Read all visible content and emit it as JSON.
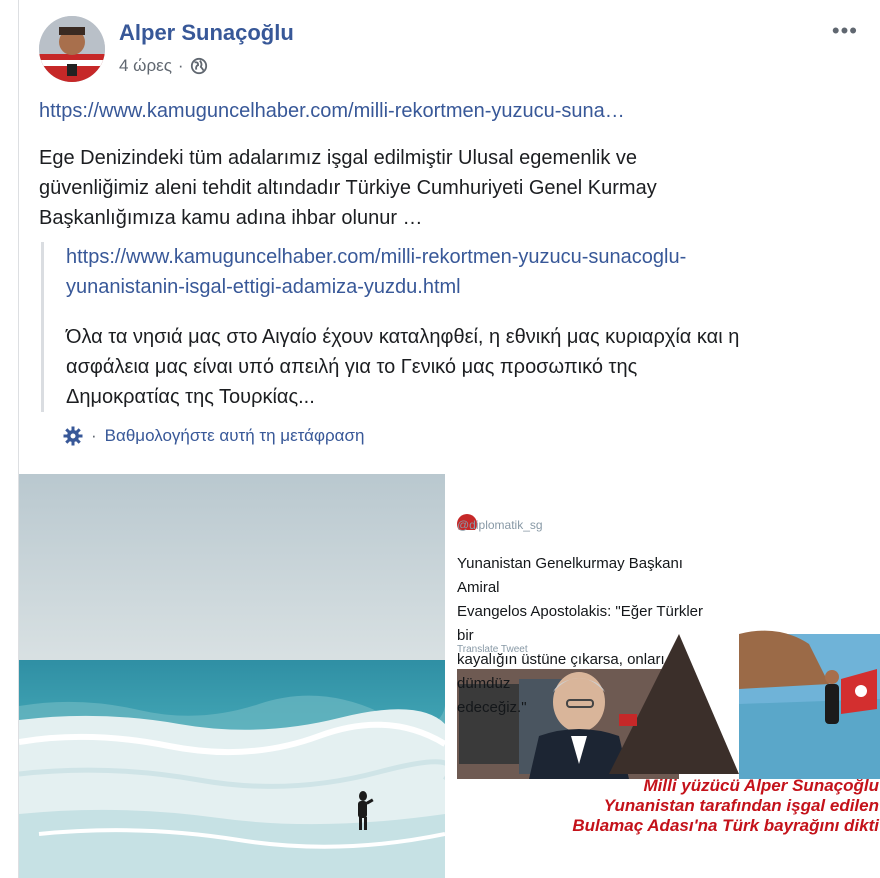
{
  "post": {
    "author": "Alper Sunaçoğlu",
    "time": "4 ώρες",
    "time_separator": "·",
    "more_label": "•••",
    "link": "https://www.kamuguncelhaber.com/milli-rekortmen-yuzucu-suna…",
    "text_lines": [
      "Ege Denizindeki tüm adalarımız işgal edilmiştir Ulusal egemenlik ve",
      "güvenliğimiz aleni tehdit altındadır Türkiye Cumhuriyeti Genel Kurmay",
      "Başkanlığımıza kamu adına ihbar olunur …"
    ],
    "quote_link_lines": [
      "https://www.kamuguncelhaber.com/milli-rekortmen-yuzucu-sunacoglu-",
      "yunanistanin-isgal-ettigi-adamiza-yuzdu.html"
    ],
    "translation_lines": [
      "Όλα τα νησιά μας στο Αιγαίο έχουν καταληφθεί, η εθνική μας κυριαρχία και η",
      "ασφάλεια μας είναι υπό απειλή για το Γενικό μας προσωπικό της",
      "Δημοκρατίας της Τουρκίας..."
    ],
    "rate_separator": "·",
    "rate_translation": "Βαθμολογήστε αυτή τη μετάφραση"
  },
  "image_right": {
    "handle": "@diplomatik_sg",
    "tweet_lines": [
      "Yunanistan Genelkurmay Başkanı Amiral",
      "Evangelos Apostolakis: \"Eğer Türkler bir",
      "kayalığın üstüne çıkarsa, onları dümdüz",
      "edeceğiz.\""
    ],
    "translate_tweet": "Translate Tweet",
    "caption_lines": [
      "Milli yüzücü Alper Sunaçoğlu",
      "Yunanistan tarafından işgal edilen",
      "Bulamaç Adası'na Türk bayrağını dikti"
    ]
  },
  "colors": {
    "link": "#385898",
    "text": "#1c1e21",
    "meta": "#606770",
    "caption": "#c4121a"
  },
  "icons": [
    "avatar",
    "globe-icon",
    "more-options-icon",
    "gear-icon"
  ]
}
